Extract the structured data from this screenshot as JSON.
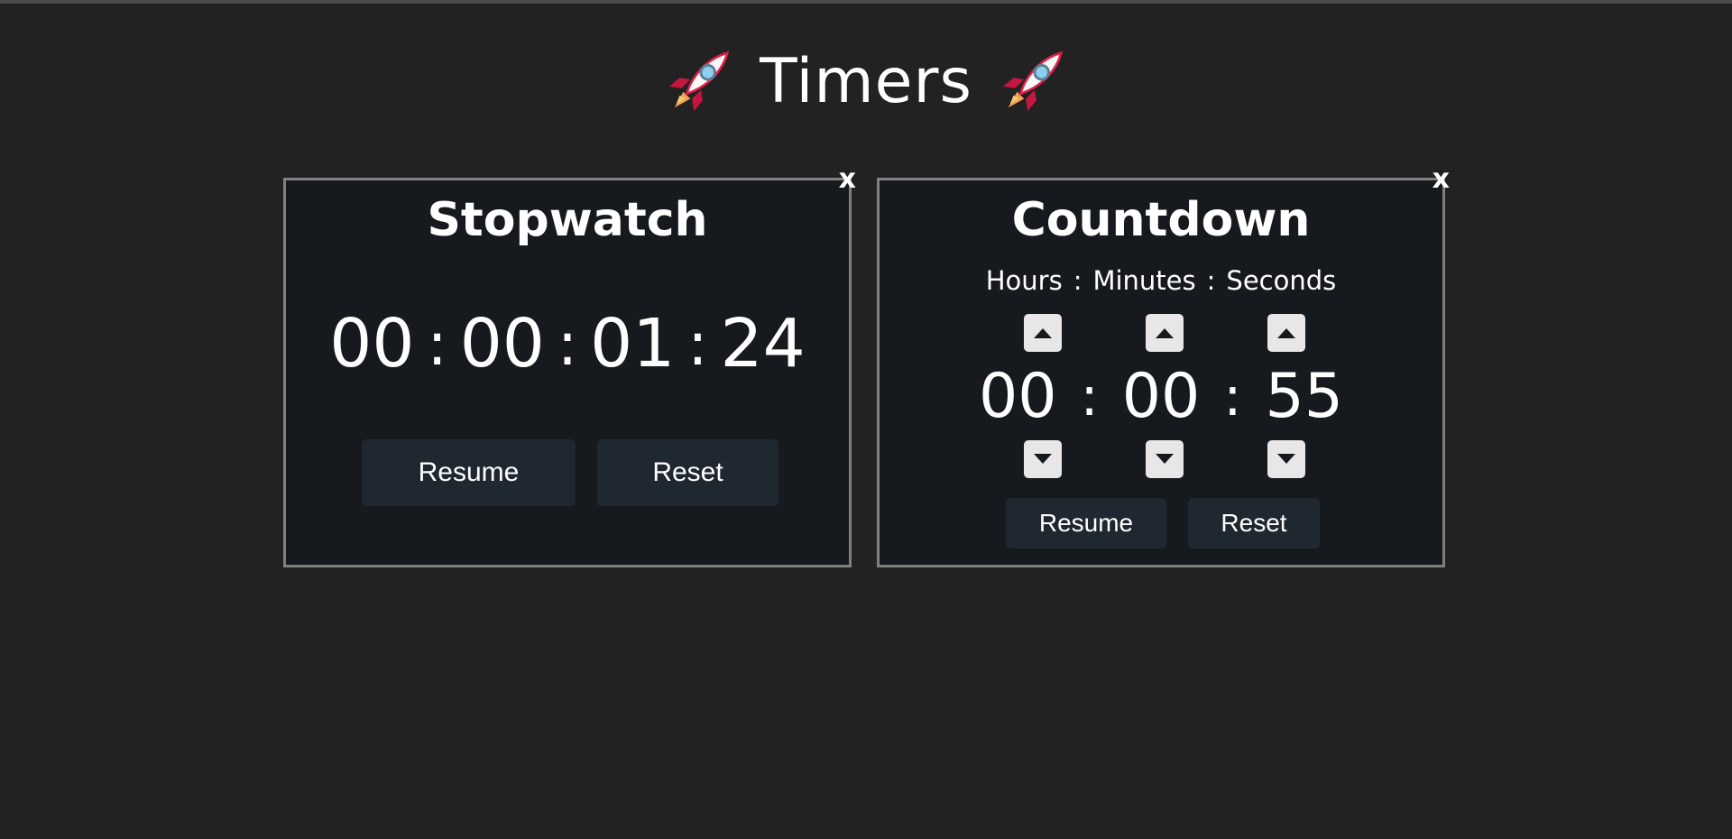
{
  "header": {
    "title": "Timers"
  },
  "stopwatch": {
    "title": "Stopwatch",
    "close_label": "x",
    "hours": "00",
    "minutes": "00",
    "seconds": "01",
    "centiseconds": "24",
    "separator": ":",
    "resume_label": "Resume",
    "reset_label": "Reset"
  },
  "countdown": {
    "title": "Countdown",
    "close_label": "x",
    "labels": {
      "hours": "Hours",
      "minutes": "Minutes",
      "seconds": "Seconds",
      "separator": ":"
    },
    "hours": "00",
    "minutes": "00",
    "seconds": "55",
    "separator": ":",
    "resume_label": "Resume",
    "reset_label": "Reset"
  },
  "icons": {
    "rocket": "rocket-icon",
    "arrow_up": "arrow-up-icon",
    "arrow_down": "arrow-down-icon"
  },
  "colors": {
    "background": "#222222",
    "card_background": "#161a1e",
    "card_border": "#808080",
    "button_background": "#1f2731",
    "arrow_background": "#e8e6e6",
    "text": "#ffffff"
  }
}
